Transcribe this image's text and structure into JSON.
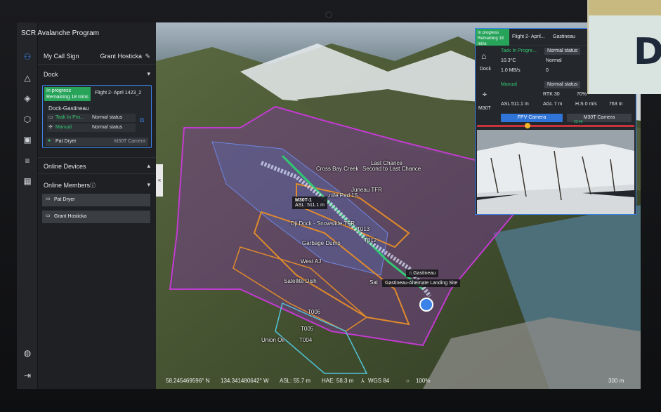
{
  "app": {
    "title": "SCR Avalanche Program"
  },
  "sidebar": {
    "call_sign_label": "My Call Sign",
    "call_sign_value": "Grant Hosticka",
    "dock_section": "Dock",
    "dock_card": {
      "status": "In progress",
      "remaining": "Remaining 18 mins",
      "flight": "Flight 2- April 1423_2",
      "dock_name": "Dock-Gastineau",
      "task_label": "Task In Pro...",
      "task_status": "Normal status",
      "mode_label": "Manual",
      "mode_status": "Normal status",
      "pilot": "Pat Dryer",
      "camera": "M30T Camera"
    },
    "online_devices": "Online Devices",
    "online_members": "Online Members",
    "members": [
      "Pat Dryer",
      "Grant Hosticka"
    ]
  },
  "map": {
    "labels": {
      "cross_bay": "Cross Bay Creek",
      "second_last": "Second to Last Chance",
      "last_chance": "Last Chance",
      "juneau": "Juneau TFR",
      "nife": "...nife Pad 15",
      "dji_dock": "Dji Dock - Snowslide TFR",
      "garbage": "Garbage Dump",
      "t012": "T012",
      "t013": "T013",
      "west_aj": "West AJ",
      "satellite": "Satellite Dish",
      "t006": "T006",
      "t005": "T005",
      "t004": "T004",
      "union_oil": "Union Oil",
      "gastineau": "Gastineau",
      "alt_landing": "Gastineau-Alternate Landing Site",
      "sat": "Sat"
    },
    "drone_tip": {
      "name": "M30T-1",
      "asl": "ASL: 511.1 m"
    },
    "status_bar": {
      "lat": "58.245469596° N",
      "lon": "134.341480642° W",
      "asl": "ASL: 55.7 m",
      "hae": "HAE: 58.3 m",
      "datum": "WGS 84",
      "zoom": "100%",
      "scale": "300 m"
    }
  },
  "overlay": {
    "status": "In progress",
    "remaining": "Remaining 18 mins",
    "flight": "Flight 2- April...",
    "location": "Gastineau",
    "dock_label": "Dock",
    "dock_task": "Task In Progre...",
    "dock_task_status": "Normal status",
    "temp": "10.3°C",
    "humidity": "Normal",
    "network": "1.0 MB/s",
    "storage": "0",
    "aircraft_label": "M30T",
    "ac_mode": "Manual",
    "ac_mode_status": "Normal status",
    "rtk": "RTK 30",
    "battery": "70%",
    "asl": "ASL 511.1 m",
    "agl": "AGL 7 m",
    "hspeed": "H.S 0 m/s",
    "distance": "763 m",
    "fpv_btn": "FPV Camera",
    "m30t_btn": "M30T Camera",
    "timeline_time": "22:46"
  },
  "colors": {
    "accent": "#3a82e8",
    "success": "#27a35a",
    "zone_magenta": "#c23bd0",
    "zone_orange": "#e08a2c"
  }
}
